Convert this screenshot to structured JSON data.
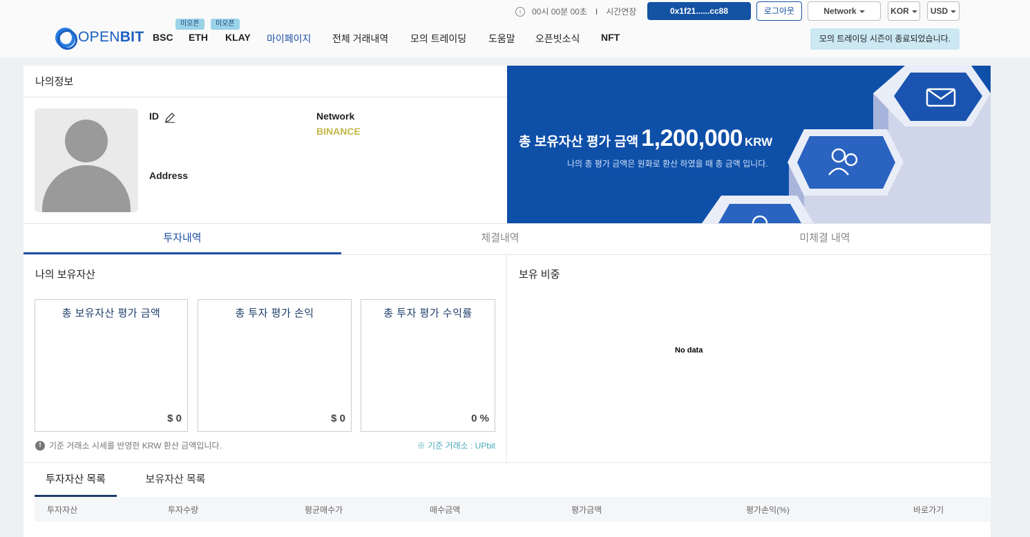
{
  "header": {
    "logo": "OPENBIT",
    "timer": "00시 00분 00초",
    "separator": "I",
    "extend_label": "시간연장",
    "wallet": "0x1f21......cc88",
    "logout": "로그아웃",
    "network_dd": "Network",
    "lang_dd": "KOR",
    "currency_dd": "USD",
    "notice": "모의 트레이딩 시즌이 종료되었습니다.",
    "nav": [
      {
        "label": "BSC"
      },
      {
        "label": "ETH",
        "badge": "미오픈"
      },
      {
        "label": "KLAY",
        "badge": "미오픈"
      },
      {
        "label": "마이페이지"
      },
      {
        "label": "전체 거래내역"
      },
      {
        "label": "모의 트레이딩"
      },
      {
        "label": "도움말"
      },
      {
        "label": "오픈빗소식"
      },
      {
        "label": "NFT"
      }
    ]
  },
  "profile": {
    "title": "나의정보",
    "id_label": "ID",
    "network_label": "Network",
    "network_value": "BINANCE",
    "address_label": "Address"
  },
  "banner": {
    "title": "총 보유자산 평가 금액",
    "amount": "1,200,000",
    "currency": "KRW",
    "subtitle": "나의 총 평가 금액은 원화로 환산 하였을 때 총 금액 입니다."
  },
  "tabs": [
    "투자내역",
    "체결내역",
    "미체결 내역"
  ],
  "holdings": {
    "title": "나의 보유자산",
    "boxes": [
      {
        "title": "총 보유자산 평가 금액",
        "value": "$ 0"
      },
      {
        "title": "총 투자 평가 손익",
        "value": "$ 0"
      },
      {
        "title": "총 투자 평가 수익률",
        "value": "0 %"
      }
    ],
    "footnote": "기준 거래소 시세를 반영한 KRW 환산 금액입니다.",
    "reference": "※ 기준 거래소 : UPbit"
  },
  "ratio": {
    "title": "보유 비중",
    "empty": "No data"
  },
  "list": {
    "tabs": [
      "투자자산 목록",
      "보유자산 목록"
    ],
    "columns": [
      "투자자산",
      "투자수량",
      "평균매수가",
      "매수금액",
      "평가금액",
      "평가손익(%)",
      "바로가기"
    ]
  },
  "colors": {
    "primary": "#1452a3",
    "banner": "#0e4fa8",
    "accent_yellow": "#c3b84a",
    "badge": "#9ad3e8",
    "reference": "#49a9b8"
  }
}
